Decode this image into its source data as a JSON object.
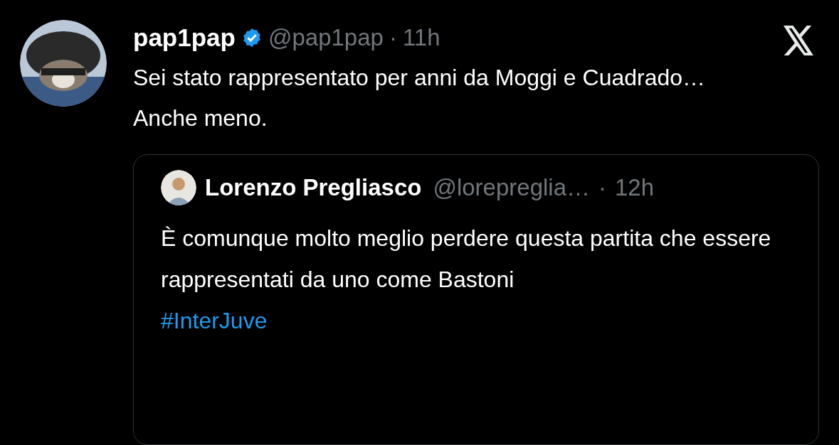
{
  "tweet": {
    "author": {
      "name": "pap1pap",
      "verified": true,
      "handle": "@pap1pap",
      "separator": "·",
      "time": "11h"
    },
    "paragraphs": [
      "Sei stato rappresentato per anni da Moggi e Cuadrado…",
      "Anche meno."
    ],
    "quote": {
      "author": {
        "name": "Lorenzo Pregliasco",
        "handle": "@lorepreglia…",
        "separator": "·",
        "time": "12h"
      },
      "text": "È comunque molto meglio perdere questa partita che essere rappresentati da uno come Bastoni",
      "hashtag": "#InterJuve"
    }
  }
}
